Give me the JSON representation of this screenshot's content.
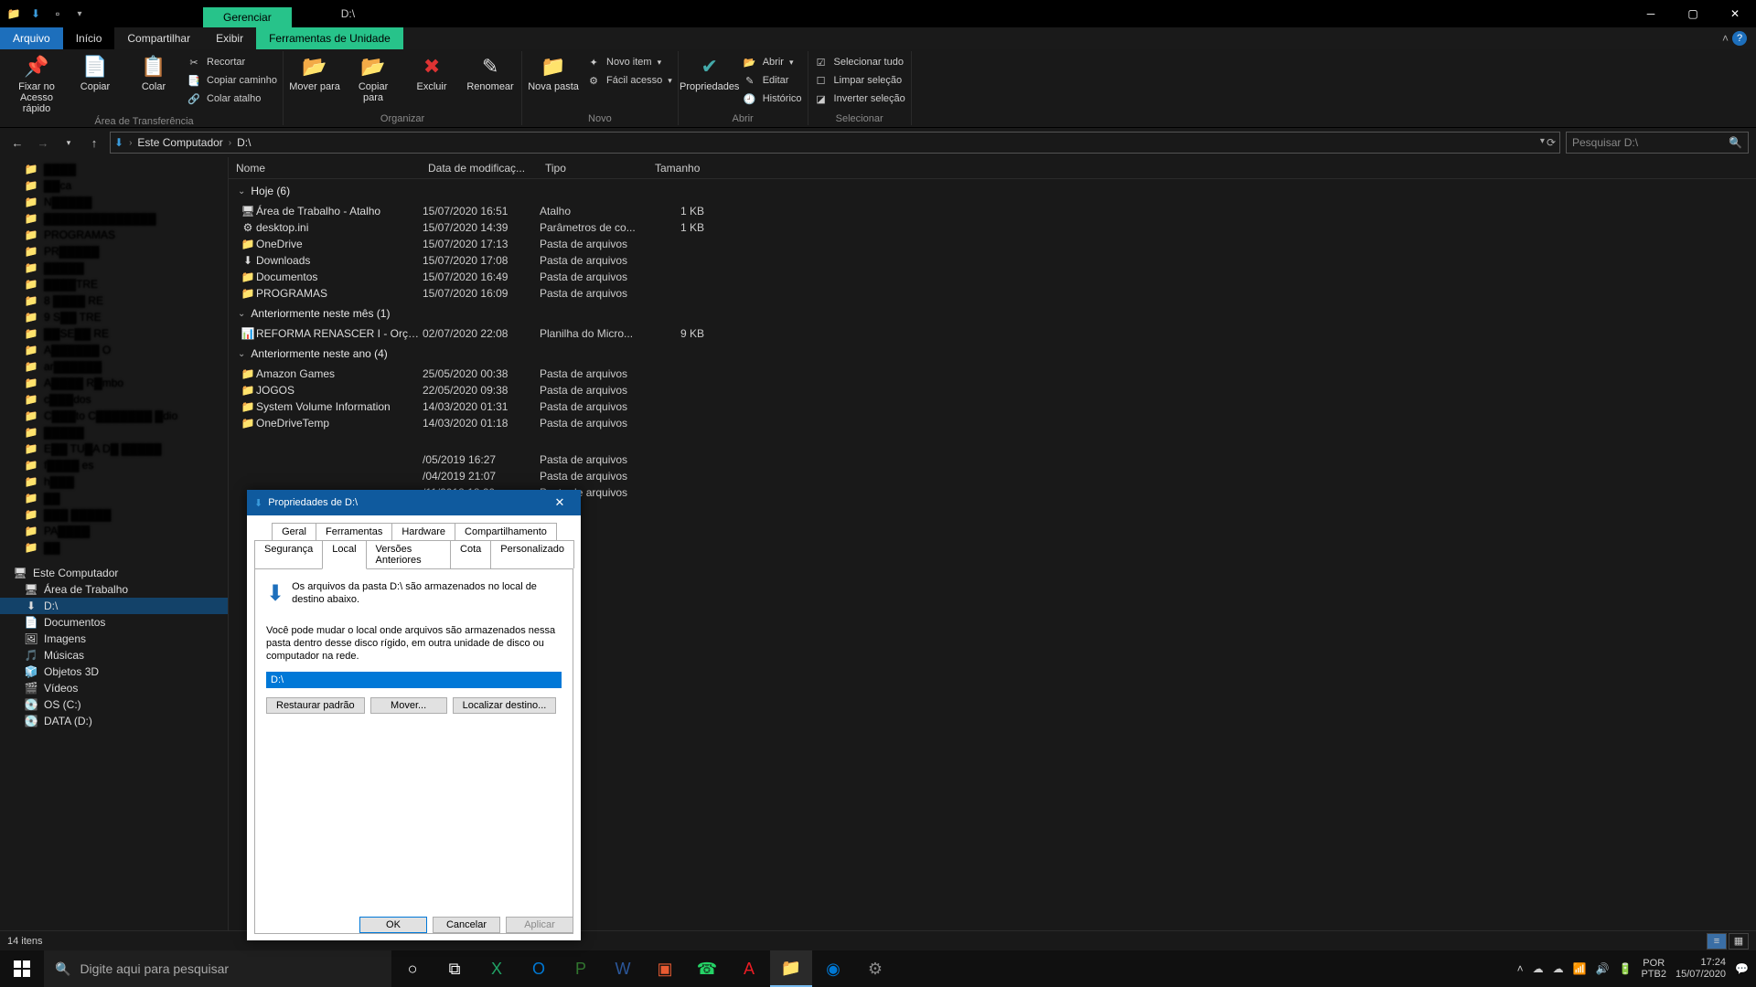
{
  "window": {
    "title": "D:\\",
    "manage_tab": "Gerenciar",
    "tools_tab": "Ferramentas de Unidade"
  },
  "tabs": {
    "file": "Arquivo",
    "home": "Início",
    "share": "Compartilhar",
    "view": "Exibir"
  },
  "ribbon": {
    "pin": "Fixar no Acesso rápido",
    "copy": "Copiar",
    "paste": "Colar",
    "cut": "Recortar",
    "copypath": "Copiar caminho",
    "pasteshortcut": "Colar atalho",
    "clipboard_group": "Área de Transferência",
    "moveto": "Mover para",
    "copyto": "Copiar para",
    "delete": "Excluir",
    "rename": "Renomear",
    "organize_group": "Organizar",
    "newfolder": "Nova pasta",
    "newitem": "Novo item",
    "easyaccess": "Fácil acesso",
    "new_group": "Novo",
    "properties": "Propriedades",
    "open": "Abrir",
    "edit": "Editar",
    "history": "Histórico",
    "open_group": "Abrir",
    "selectall": "Selecionar tudo",
    "selectnone": "Limpar seleção",
    "invert": "Inverter seleção",
    "select_group": "Selecionar"
  },
  "address": {
    "pc": "Este Computador",
    "loc": "D:\\"
  },
  "search": {
    "placeholder": "Pesquisar D:\\"
  },
  "columns": {
    "name": "Nome",
    "date": "Data de modificaç...",
    "type": "Tipo",
    "size": "Tamanho"
  },
  "groups": {
    "today": "Hoje (6)",
    "earlier_month": "Anteriormente neste mês (1)",
    "earlier_year": "Anteriormente neste ano (4)"
  },
  "files_today": [
    {
      "icon": "🖥",
      "name": "Área de Trabalho - Atalho",
      "date": "15/07/2020 16:51",
      "type": "Atalho",
      "size": "1 KB"
    },
    {
      "icon": "⚙",
      "name": "desktop.ini",
      "date": "15/07/2020 14:39",
      "type": "Parâmetros de co...",
      "size": "1 KB"
    },
    {
      "icon": "📁",
      "name": "OneDrive",
      "date": "15/07/2020 17:13",
      "type": "Pasta de arquivos",
      "size": ""
    },
    {
      "icon": "⬇",
      "name": "Downloads",
      "date": "15/07/2020 17:08",
      "type": "Pasta de arquivos",
      "size": ""
    },
    {
      "icon": "📁",
      "name": "Documentos",
      "date": "15/07/2020 16:49",
      "type": "Pasta de arquivos",
      "size": ""
    },
    {
      "icon": "📁",
      "name": "PROGRAMAS",
      "date": "15/07/2020 16:09",
      "type": "Pasta de arquivos",
      "size": ""
    }
  ],
  "files_month": [
    {
      "icon": "📊",
      "name": "REFORMA RENASCER I - Orçamento Sint...",
      "date": "02/07/2020 22:08",
      "type": "Planilha do Micro...",
      "size": "9 KB"
    }
  ],
  "files_year": [
    {
      "icon": "📁",
      "name": "Amazon Games",
      "date": "25/05/2020 00:38",
      "type": "Pasta de arquivos",
      "size": ""
    },
    {
      "icon": "📁",
      "name": "JOGOS",
      "date": "22/05/2020 09:38",
      "type": "Pasta de arquivos",
      "size": ""
    },
    {
      "icon": "📁",
      "name": "System Volume Information",
      "date": "14/03/2020 01:31",
      "type": "Pasta de arquivos",
      "size": ""
    },
    {
      "icon": "📁",
      "name": "OneDriveTemp",
      "date": "14/03/2020 01:18",
      "type": "Pasta de arquivos",
      "size": ""
    }
  ],
  "files_after_dialog": [
    {
      "date": "/05/2019 16:27",
      "type": "Pasta de arquivos"
    },
    {
      "date": "/04/2019 21:07",
      "type": "Pasta de arquivos"
    },
    {
      "date": "/11/2018 18:29",
      "type": "Pasta de arquivos"
    }
  ],
  "nav_quick": [
    "▓▓▓▓",
    "▓▓ca",
    "N▓▓▓▓▓",
    "▓▓▓▓▓▓▓▓▓▓▓▓▓▓",
    "PROGRAMAS",
    "PR▓▓▓▓▓",
    "▓▓▓▓▓",
    "▓▓▓▓TRE",
    "8 ▓▓▓▓ RE",
    "9 S▓▓ TRE",
    "▓▓SE▓▓ RE",
    "A▓▓▓▓▓▓ O",
    "ar▓▓▓▓▓▓",
    "A▓▓▓▓ R▓mbo",
    "c▓▓▓dos",
    "C▓▓▓to C▓▓▓▓▓▓▓ ▓dio",
    "▓▓▓▓▓",
    "E▓▓ TU▓A D▓ ▓▓▓▓▓",
    "f▓▓▓▓ es",
    "h▓▓▓",
    "▓▓",
    "▓▓▓ ▓▓▓▓▓",
    "PA▓▓▓▓",
    "▓▓"
  ],
  "nav_pc": {
    "root": "Este Computador",
    "items": [
      "Área de Trabalho",
      "D:\\",
      "Documentos",
      "Imagens",
      "Músicas",
      "Objetos 3D",
      "Vídeos",
      "OS (C:)",
      "DATA (D:)"
    ]
  },
  "status": {
    "count": "14 itens"
  },
  "dialog": {
    "title": "Propriedades de D:\\",
    "tabs_row1": [
      "Geral",
      "Ferramentas",
      "Hardware",
      "Compartilhamento"
    ],
    "tabs_row2": [
      "Segurança",
      "Local",
      "Versões Anteriores",
      "Cota",
      "Personalizado"
    ],
    "active_tab": "Local",
    "msg1": "Os arquivos da pasta D:\\ são armazenados no local de destino abaixo.",
    "msg2": "Você pode mudar o local onde arquivos são armazenados nessa pasta dentro desse disco rígido, em outra unidade de disco ou computador na rede.",
    "path": "D:\\",
    "btn_restore": "Restaurar padrão",
    "btn_move": "Mover...",
    "btn_find": "Localizar destino...",
    "ok": "OK",
    "cancel": "Cancelar",
    "apply": "Aplicar"
  },
  "taskbar": {
    "search_placeholder": "Digite aqui para pesquisar",
    "lang": "POR",
    "kbd": "PTB2",
    "time": "17:24",
    "date": "15/07/2020"
  }
}
